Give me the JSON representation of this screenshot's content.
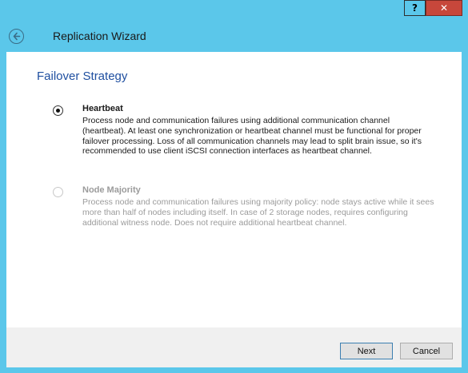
{
  "window": {
    "help_label": "?",
    "close_label": "✕"
  },
  "header": {
    "title": "Replication Wizard",
    "back_icon": "back-arrow-icon"
  },
  "section": {
    "title": "Failover Strategy"
  },
  "options": [
    {
      "title": "Heartbeat",
      "selected": true,
      "enabled": true,
      "description": "Process node and communication failures using additional communication channel (heartbeat). At least one synchronization or heartbeat channel must be functional for proper failover processing. Loss of all communication channels may lead to split brain issue, so it's recommended to use client iSCSI connection interfaces as heartbeat channel."
    },
    {
      "title": "Node Majority",
      "selected": false,
      "enabled": false,
      "description": "Process node and communication failures using majority policy: node stays active while it sees more than half of nodes including itself. In case of 2 storage nodes, requires configuring additional witness node. Does not require additional heartbeat channel."
    }
  ],
  "footer": {
    "next_label": "Next",
    "cancel_label": "Cancel"
  },
  "colors": {
    "frame": "#5bc7ea",
    "section_title": "#1f4fa0",
    "close_button": "#c7473b",
    "disabled_text": "#9b9b9b"
  }
}
